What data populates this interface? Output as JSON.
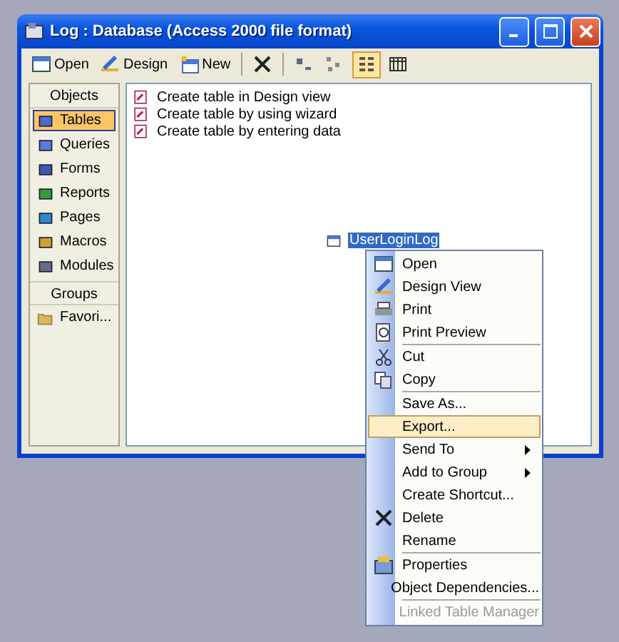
{
  "window": {
    "title": "Log : Database (Access 2000 file format)"
  },
  "toolbar": [
    {
      "kind": "open",
      "label": "Open"
    },
    {
      "kind": "design",
      "label": "Design"
    },
    {
      "kind": "new",
      "label": "New"
    },
    {
      "kind": "delete"
    },
    {
      "kind": "large-icons",
      "selected": false
    },
    {
      "kind": "small-icons",
      "selected": false
    },
    {
      "kind": "list",
      "selected": true
    },
    {
      "kind": "details",
      "selected": false
    }
  ],
  "sidebar": {
    "objects_header": "Objects",
    "items": [
      {
        "kind": "tables",
        "label": "Tables",
        "selected": true
      },
      {
        "kind": "queries",
        "label": "Queries",
        "selected": false
      },
      {
        "kind": "forms",
        "label": "Forms",
        "selected": false
      },
      {
        "kind": "reports",
        "label": "Reports",
        "selected": false
      },
      {
        "kind": "pages",
        "label": "Pages",
        "selected": false
      },
      {
        "kind": "macros",
        "label": "Macros",
        "selected": false
      },
      {
        "kind": "modules",
        "label": "Modules",
        "selected": false
      }
    ],
    "groups_header": "Groups",
    "groups": [
      {
        "label": "Favori..."
      }
    ]
  },
  "list": [
    {
      "label": "Create table in Design view"
    },
    {
      "label": "Create table by using wizard"
    },
    {
      "label": "Create table by entering data"
    }
  ],
  "selected_object": {
    "label": "UserLoginLog",
    "selected": true
  },
  "context_menu": [
    {
      "label": "Open",
      "kind": "open",
      "highlighted": false,
      "disabled": false
    },
    {
      "label": "Design View",
      "kind": "design",
      "highlighted": false,
      "disabled": false
    },
    {
      "label": "Print",
      "kind": "print",
      "highlighted": false,
      "disabled": false
    },
    {
      "label": "Print Preview",
      "kind": "preview",
      "separator_after": true,
      "highlighted": false,
      "disabled": false
    },
    {
      "label": "Cut",
      "kind": "cut",
      "highlighted": false,
      "disabled": false
    },
    {
      "label": "Copy",
      "kind": "copy",
      "separator_after": true,
      "highlighted": false,
      "disabled": false
    },
    {
      "label": "Save As...",
      "highlighted": false,
      "disabled": false
    },
    {
      "label": "Export...",
      "highlighted": true,
      "disabled": false
    },
    {
      "label": "Send To",
      "submenu": true,
      "highlighted": false,
      "disabled": false
    },
    {
      "label": "Add to Group",
      "submenu": true,
      "highlighted": false,
      "disabled": false
    },
    {
      "label": "Create Shortcut...",
      "highlighted": false,
      "disabled": false
    },
    {
      "label": "Delete",
      "kind": "delete",
      "highlighted": false,
      "disabled": false
    },
    {
      "label": "Rename",
      "separator_after": true,
      "highlighted": false,
      "disabled": false
    },
    {
      "label": "Properties",
      "kind": "properties",
      "highlighted": false,
      "disabled": false
    },
    {
      "label": "Object Dependencies...",
      "separator_after": true,
      "highlighted": false,
      "disabled": false
    },
    {
      "label": "Linked Table Manager",
      "highlighted": false,
      "disabled": true
    }
  ]
}
